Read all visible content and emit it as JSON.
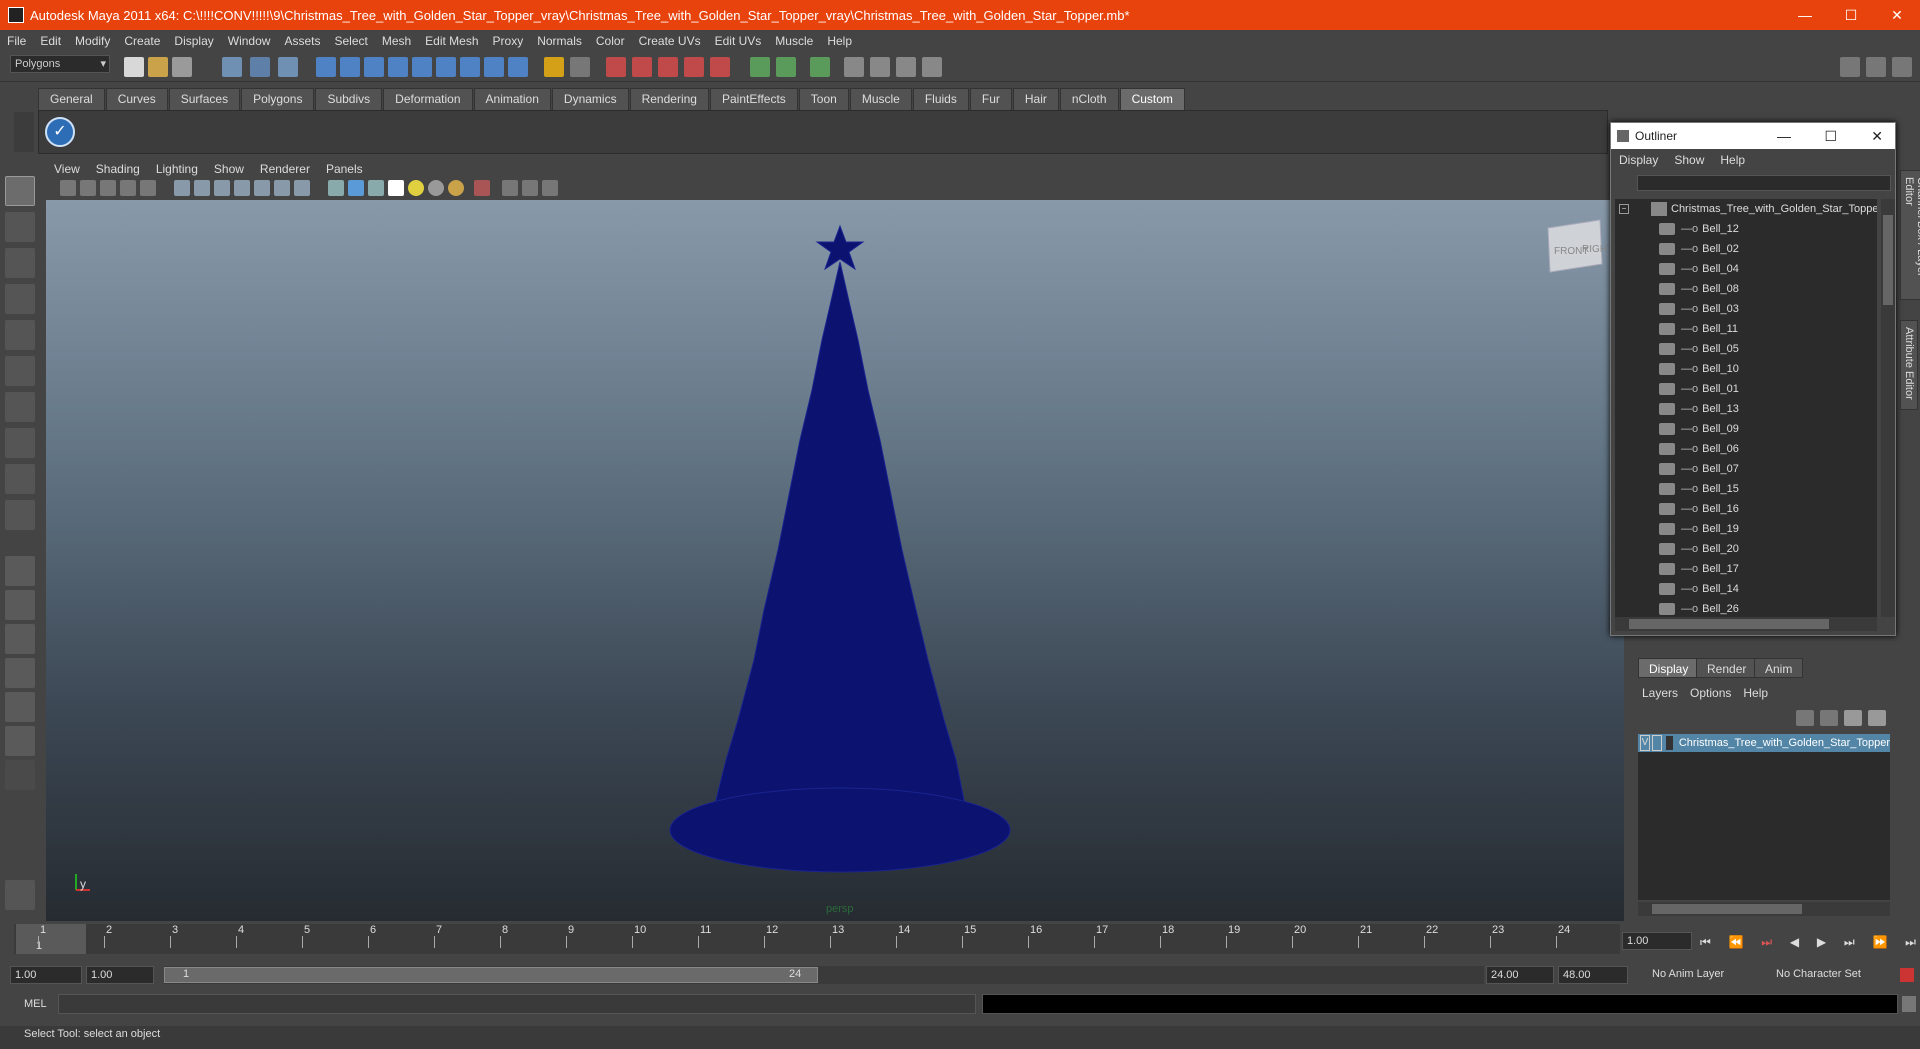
{
  "window": {
    "title": "Autodesk Maya 2011 x64: C:\\!!!!CONV!!!!!\\9\\Christmas_Tree_with_Golden_Star_Topper_vray\\Christmas_Tree_with_Golden_Star_Topper_vray\\Christmas_Tree_with_Golden_Star_Topper.mb*",
    "minimize": "—",
    "maximize": "☐",
    "close": "✕"
  },
  "menu": [
    "File",
    "Edit",
    "Modify",
    "Create",
    "Display",
    "Window",
    "Assets",
    "Select",
    "Mesh",
    "Edit Mesh",
    "Proxy",
    "Normals",
    "Color",
    "Create UVs",
    "Edit UVs",
    "Muscle",
    "Help"
  ],
  "statusline": {
    "mode": "Polygons"
  },
  "shelf": {
    "tabs": [
      "General",
      "Curves",
      "Surfaces",
      "Polygons",
      "Subdivs",
      "Deformation",
      "Animation",
      "Dynamics",
      "Rendering",
      "PaintEffects",
      "Toon",
      "Muscle",
      "Fluids",
      "Fur",
      "Hair",
      "nCloth",
      "Custom"
    ],
    "active_tab": "Custom"
  },
  "viewport": {
    "menu": [
      "View",
      "Shading",
      "Lighting",
      "Show",
      "Renderer",
      "Panels"
    ],
    "camera_label": "persp",
    "viewcube": {
      "front": "FRONT",
      "right": "RIGHT"
    },
    "axis_y": "y",
    "model_color": "#0b1270"
  },
  "outliner": {
    "title": "Outliner",
    "menu": [
      "Display",
      "Show",
      "Help"
    ],
    "root": "Christmas_Tree_with_Golden_Star_Topper",
    "items": [
      "Bell_12",
      "Bell_02",
      "Bell_04",
      "Bell_08",
      "Bell_03",
      "Bell_11",
      "Bell_05",
      "Bell_10",
      "Bell_01",
      "Bell_13",
      "Bell_09",
      "Bell_06",
      "Bell_07",
      "Bell_15",
      "Bell_16",
      "Bell_19",
      "Bell_20",
      "Bell_17",
      "Bell_14",
      "Bell_26"
    ]
  },
  "side_tabs": {
    "channel_box": "Channel Box / Layer Editor",
    "attribute_editor": "Attribute Editor"
  },
  "layer_editor": {
    "tabs": [
      "Display",
      "Render",
      "Anim"
    ],
    "active_tab": "Display",
    "menu": [
      "Layers",
      "Options",
      "Help"
    ],
    "layer": {
      "visible": "V",
      "name": "Christmas_Tree_with_Golden_Star_Topper"
    }
  },
  "timeline": {
    "ticks": [
      "1",
      "2",
      "3",
      "4",
      "5",
      "6",
      "7",
      "8",
      "9",
      "10",
      "11",
      "12",
      "13",
      "14",
      "15",
      "16",
      "17",
      "18",
      "19",
      "20",
      "21",
      "22",
      "23",
      "24"
    ],
    "current_frame": "1",
    "current_time_field": "1.00"
  },
  "range": {
    "start_time": "1.00",
    "playback_start": "1.00",
    "range_start": "1",
    "range_end": "24",
    "playback_end": "24.00",
    "end_time": "48.00",
    "anim_layer": "No Anim Layer",
    "character_set": "No Character Set"
  },
  "command_line": {
    "label": "MEL"
  },
  "help_line": {
    "text": "Select Tool: select an object"
  }
}
